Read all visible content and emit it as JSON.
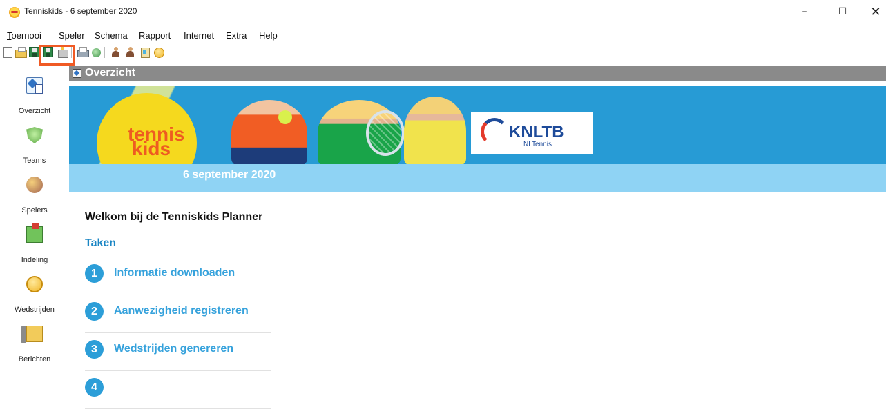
{
  "window": {
    "title": "Tenniskids - 6 september 2020",
    "minimize": "–",
    "maximize": "☐",
    "close": "✕"
  },
  "menu": {
    "items": [
      {
        "label": "Toernooi",
        "underline": "T",
        "rest": "oernooi"
      },
      {
        "label": "Speler"
      },
      {
        "label": "Schema"
      },
      {
        "label": "Rapport"
      },
      {
        "label": "Internet"
      },
      {
        "label": "Extra"
      },
      {
        "label": "Help"
      }
    ]
  },
  "sidebar": {
    "items": [
      {
        "label": "Overzicht",
        "icon": "overview-icon"
      },
      {
        "label": "Teams",
        "icon": "teams-shield-icon"
      },
      {
        "label": "Spelers",
        "icon": "players-icon"
      },
      {
        "label": "Indeling",
        "icon": "grouping-icon"
      },
      {
        "label": "Wedstrijden",
        "icon": "matches-icon"
      },
      {
        "label": "Berichten",
        "icon": "messages-icon"
      }
    ]
  },
  "main": {
    "header_title": "Overzicht",
    "banner": {
      "logo_line1": "tennis",
      "logo_line2": "kids",
      "date": "6 september 2020",
      "partner_logo": "KNLTB",
      "partner_sub": "NLTennis"
    },
    "welcome": "Welkom bij de Tenniskids Planner",
    "tasks_title": "Taken",
    "tasks": [
      {
        "num": "1",
        "label": "Informatie downloaden"
      },
      {
        "num": "2",
        "label": "Aanwezigheid registreren"
      },
      {
        "num": "3",
        "label": "Wedstrijden genereren"
      },
      {
        "num": "4",
        "label": ""
      }
    ]
  },
  "colors": {
    "accent_blue": "#279bd5",
    "link_blue": "#36a2dc",
    "highlight": "#f05a24",
    "header_gray": "#8a8a8a"
  }
}
